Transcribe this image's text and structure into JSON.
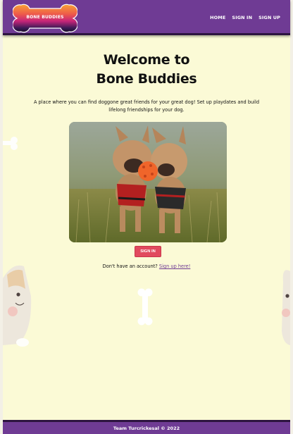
{
  "brand": {
    "logo_text": "BONE BUDDIES",
    "colors": {
      "nav_purple": "#6f3b94",
      "cream": "#fbfad6",
      "button_red": "#e14a5e",
      "logo_orange": "#f29a3a",
      "logo_magenta": "#c6257a"
    }
  },
  "nav": {
    "links": [
      {
        "label": "HOME"
      },
      {
        "label": "SIGN IN"
      },
      {
        "label": "SIGN UP"
      }
    ]
  },
  "main": {
    "title_line1": "Welcome to",
    "title_line2": "Bone Buddies",
    "intro": "A place where you can find doggone great friends for your great dog! Set up playdates and build lifelong friendships for your dog.",
    "photo_icon": "dogs-playing-photo",
    "signin_button": "SIGN IN",
    "signup_prompt": "Don't have an account?",
    "signup_link": "Sign up here!"
  },
  "footer": {
    "text": "Team Turcrickesal © 2022"
  }
}
